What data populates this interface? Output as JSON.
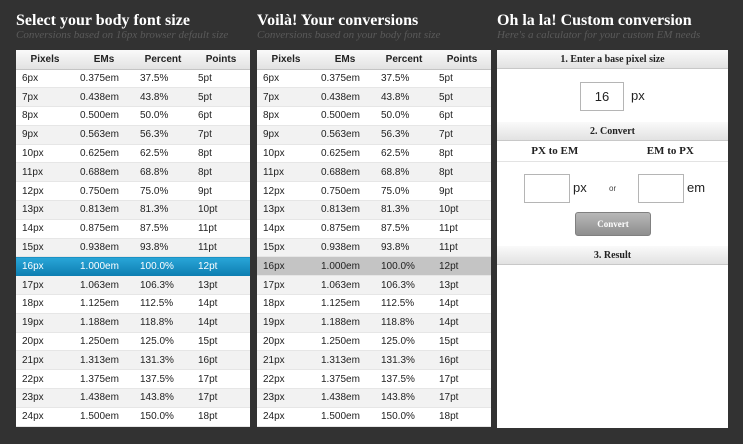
{
  "left_section": {
    "title": "Select your body font size",
    "subtitle": "Conversions based on 16px browser default size"
  },
  "middle_section": {
    "title": "Voilà! Your conversions",
    "subtitle": "Conversions based on your body font size"
  },
  "right_section": {
    "title": "Oh la la! Custom conversion",
    "subtitle": "Here's a calculator for your custom EM needs"
  },
  "table_headers": [
    "Pixels",
    "EMs",
    "Percent",
    "Points"
  ],
  "rows": [
    [
      "6px",
      "0.375em",
      "37.5%",
      "5pt"
    ],
    [
      "7px",
      "0.438em",
      "43.8%",
      "5pt"
    ],
    [
      "8px",
      "0.500em",
      "50.0%",
      "6pt"
    ],
    [
      "9px",
      "0.563em",
      "56.3%",
      "7pt"
    ],
    [
      "10px",
      "0.625em",
      "62.5%",
      "8pt"
    ],
    [
      "11px",
      "0.688em",
      "68.8%",
      "8pt"
    ],
    [
      "12px",
      "0.750em",
      "75.0%",
      "9pt"
    ],
    [
      "13px",
      "0.813em",
      "81.3%",
      "10pt"
    ],
    [
      "14px",
      "0.875em",
      "87.5%",
      "11pt"
    ],
    [
      "15px",
      "0.938em",
      "93.8%",
      "11pt"
    ],
    [
      "16px",
      "1.000em",
      "100.0%",
      "12pt"
    ],
    [
      "17px",
      "1.063em",
      "106.3%",
      "13pt"
    ],
    [
      "18px",
      "1.125em",
      "112.5%",
      "14pt"
    ],
    [
      "19px",
      "1.188em",
      "118.8%",
      "14pt"
    ],
    [
      "20px",
      "1.250em",
      "125.0%",
      "15pt"
    ],
    [
      "21px",
      "1.313em",
      "131.3%",
      "16pt"
    ],
    [
      "22px",
      "1.375em",
      "137.5%",
      "17pt"
    ],
    [
      "23px",
      "1.438em",
      "143.8%",
      "17pt"
    ],
    [
      "24px",
      "1.500em",
      "150.0%",
      "18pt"
    ]
  ],
  "selected_row_index": 10,
  "colors": {
    "background": "#323232",
    "selected_row": "#1792c8",
    "highlight_row": "#c4c4c4"
  },
  "custom": {
    "step1_label": "1. Enter a base pixel size",
    "base_value": "16",
    "base_unit": "px",
    "step2_label": "2. Convert",
    "px_to_em_label": "PX to EM",
    "em_to_px_label": "EM to PX",
    "px_unit": "px",
    "or_label": "or",
    "em_unit": "em",
    "convert_button": "Convert",
    "step3_label": "3. Result"
  }
}
